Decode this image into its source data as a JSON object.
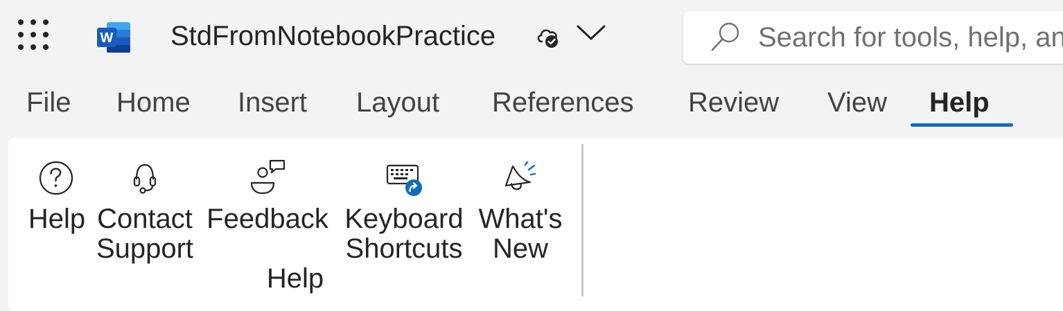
{
  "titlebar": {
    "app_launcher_icon": "app-launcher-grid-icon",
    "app_logo_icon": "word-logo-icon",
    "document_title": "StdFromNotebookPractice",
    "save_status_icon": "cloud-saved-icon",
    "title_menu_icon": "chevron-down-icon"
  },
  "search": {
    "placeholder": "Search for tools, help, and more",
    "icon": "search-icon"
  },
  "tabs": [
    {
      "label": "File"
    },
    {
      "label": "Home"
    },
    {
      "label": "Insert"
    },
    {
      "label": "Layout"
    },
    {
      "label": "References"
    },
    {
      "label": "Review"
    },
    {
      "label": "View"
    },
    {
      "label": "Help",
      "active": true
    }
  ],
  "ribbon": {
    "buttons": [
      {
        "line1": "Help",
        "line2": "",
        "line3": "",
        "icon": "help-circle-icon"
      },
      {
        "line1": "Contact",
        "line2": "Support",
        "line3": "",
        "icon": "headset-icon"
      },
      {
        "line1": "Feedback",
        "line2": "",
        "line3": "Help",
        "icon": "person-feedback-icon"
      },
      {
        "line1": "Keyboard",
        "line2": "Shortcuts",
        "line3": "",
        "icon": "keyboard-shortcuts-icon"
      },
      {
        "line1": "What's",
        "line2": "New",
        "line3": "",
        "icon": "megaphone-icon"
      }
    ]
  },
  "colors": {
    "background": "#f3f3f3",
    "accent": "#0f6cbd",
    "word_blue": "#185abd",
    "ribbon_background": "#ffffff"
  }
}
